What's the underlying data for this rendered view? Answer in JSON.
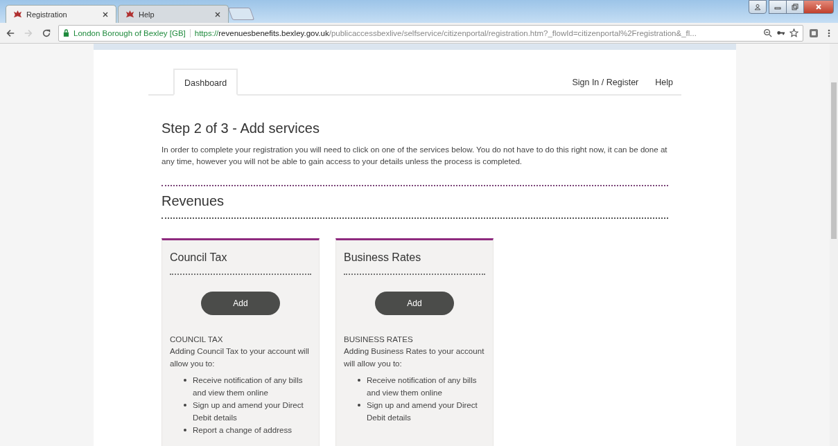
{
  "browser": {
    "tabs": [
      {
        "title": "Registration",
        "selected": true
      },
      {
        "title": "Help",
        "selected": false
      }
    ],
    "address": {
      "site": "London Borough of Bexley [GB]",
      "scheme": "https://",
      "host": "revenuesbenefits.bexley.gov.uk",
      "path": "/publicaccessbexlive/selfservice/citizenportal/registration.htm?_flowId=citizenportal%2Fregistration&_fl..."
    }
  },
  "nav": {
    "tabs": [
      {
        "label": "Dashboard",
        "selected": true
      }
    ],
    "links": [
      "Sign In / Register",
      "Help"
    ]
  },
  "heading": "Step 2 of 3 - Add services",
  "intro": "In order to complete your registration you will need to click on one of the services below. You do not have to do this right now, it can be done at any time, however you will not be able to gain access to your details unless the process is completed.",
  "section": "Revenues",
  "services": [
    {
      "title": "Council Tax",
      "button": "Add",
      "caption": "COUNCIL TAX",
      "description": "Adding Council Tax to your account will allow you to:",
      "benefits": [
        "Receive notification of any bills and view them online",
        "Sign up and amend your Direct Debit details",
        "Report a change of address"
      ]
    },
    {
      "title": "Business Rates",
      "button": "Add",
      "caption": "BUSINESS RATES",
      "description": "Adding Business Rates to your account will allow you to:",
      "benefits": [
        "Receive notification of any bills and view them online",
        "Sign up and amend your Direct Debit details"
      ]
    }
  ]
}
